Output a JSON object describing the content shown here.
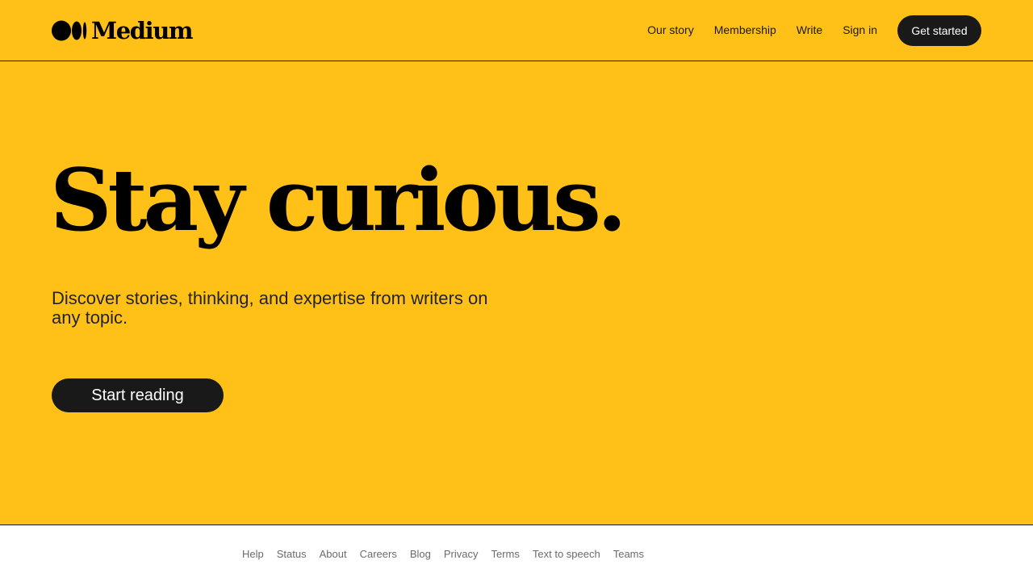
{
  "header": {
    "logo_text": "Medium",
    "nav": [
      {
        "label": "Our story"
      },
      {
        "label": "Membership"
      },
      {
        "label": "Write"
      },
      {
        "label": "Sign in"
      }
    ],
    "cta_label": "Get started"
  },
  "hero": {
    "headline": "Stay curious.",
    "subhead": "Discover stories, thinking, and expertise from writers on any topic.",
    "button_label": "Start reading"
  },
  "footer": {
    "links": [
      "Help",
      "Status",
      "About",
      "Careers",
      "Blog",
      "Privacy",
      "Terms",
      "Text to speech",
      "Teams"
    ]
  },
  "colors": {
    "hero_background": "#FFC017",
    "button_background": "#191919",
    "footer_link": "#6B6B6B"
  },
  "icons": {
    "logo_mark": "medium-logo-icon"
  }
}
